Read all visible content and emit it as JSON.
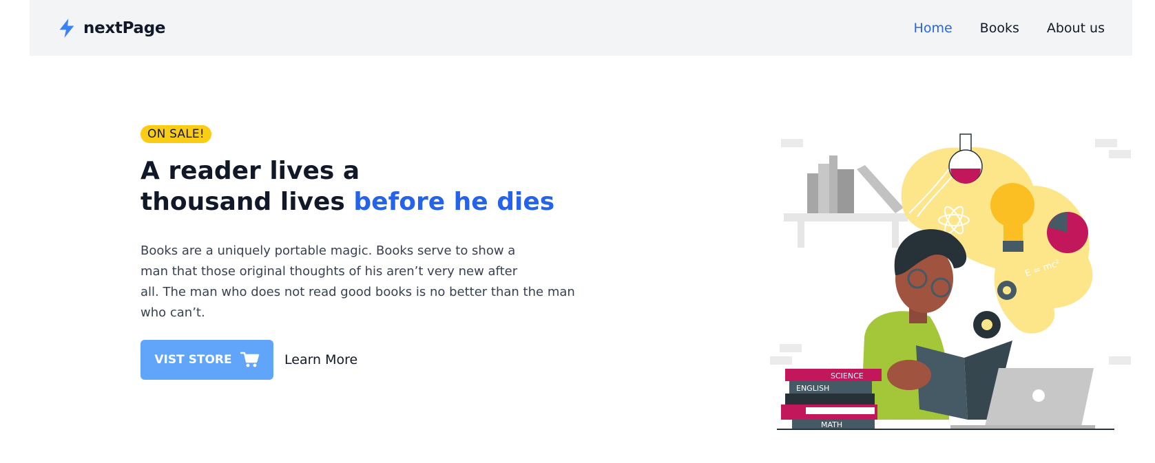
{
  "brand": {
    "name": "nextPage",
    "icon": "lightning-bolt-icon",
    "icon_color": "#3b82f6"
  },
  "nav": {
    "items": [
      {
        "label": "Home",
        "active": true
      },
      {
        "label": "Books",
        "active": false
      },
      {
        "label": "About us",
        "active": false
      }
    ],
    "active_color": "#2563eb"
  },
  "hero": {
    "badge": "ON SALE!",
    "title_line1": "A reader lives a",
    "title_line2": "thousand lives",
    "title_accent": "before he dies",
    "description_lines": [
      "Books are a uniquely portable magic. Books serve to show a",
      "man that those original thoughts of his aren’t very new after",
      "all. The man who does not read good books is no better than the man",
      "who can’t."
    ],
    "primary_button": {
      "label": "VIST STORE",
      "icon": "cart-icon"
    },
    "secondary_button": {
      "label": "Learn More"
    }
  },
  "illustration": {
    "book_spines": [
      "SCIENCE",
      "ENGLISH",
      "MATH"
    ],
    "formula": "E = mc²"
  },
  "colors": {
    "badge": "#facc15",
    "button": "#60a5fa",
    "accent": "#2563eb"
  }
}
